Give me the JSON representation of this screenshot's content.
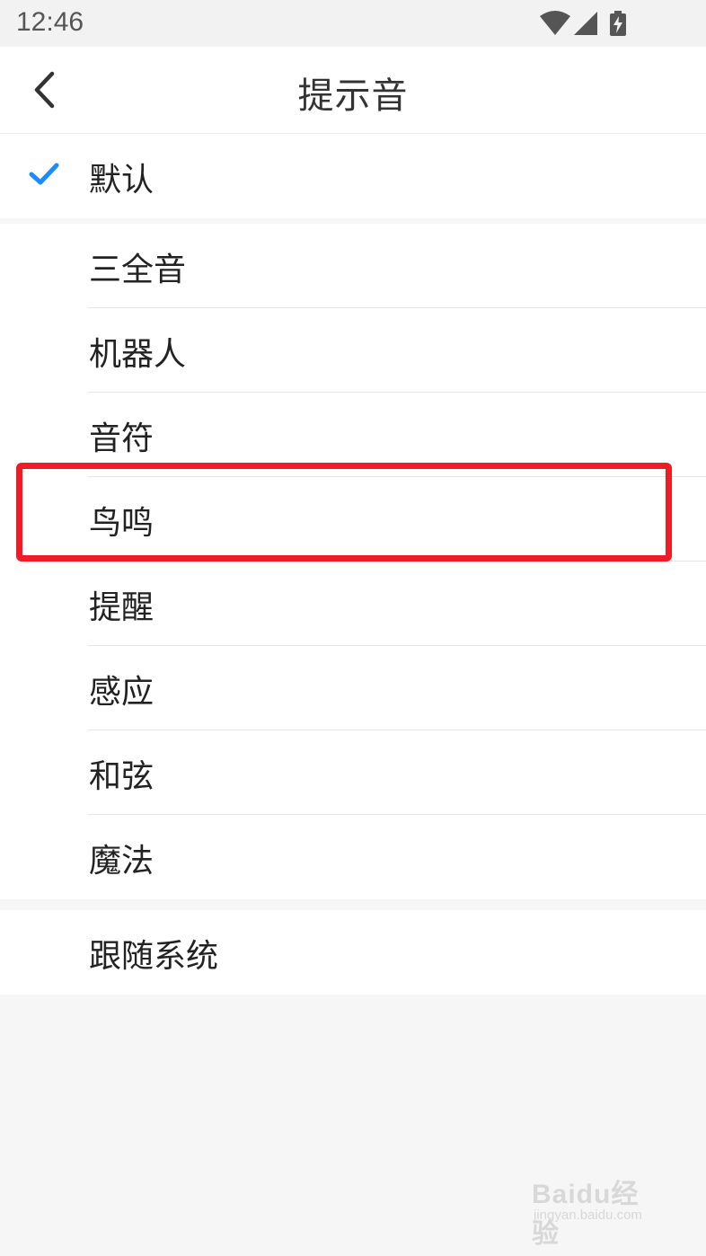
{
  "status_bar": {
    "time": "12:46",
    "icons": [
      "wifi-icon",
      "cell-signal-icon",
      "battery-charging-icon"
    ]
  },
  "header": {
    "title": "提示音",
    "back_icon": "chevron-left-icon"
  },
  "selected_group": {
    "items": [
      {
        "label": "默认",
        "selected": true
      }
    ],
    "check_color": "#1a8cff"
  },
  "sound_list": {
    "items": [
      {
        "label": "三全音"
      },
      {
        "label": "机器人"
      },
      {
        "label": "音符"
      },
      {
        "label": "鸟鸣"
      },
      {
        "label": "提醒"
      },
      {
        "label": "感应"
      },
      {
        "label": "和弦"
      },
      {
        "label": "魔法"
      }
    ]
  },
  "system_group": {
    "items": [
      {
        "label": "跟随系统"
      }
    ]
  },
  "highlight": {
    "target": "鸟鸣",
    "color": "#ee1c25"
  },
  "watermark": {
    "brand": "Baidu经验",
    "url": "jingyan.baidu.com"
  }
}
